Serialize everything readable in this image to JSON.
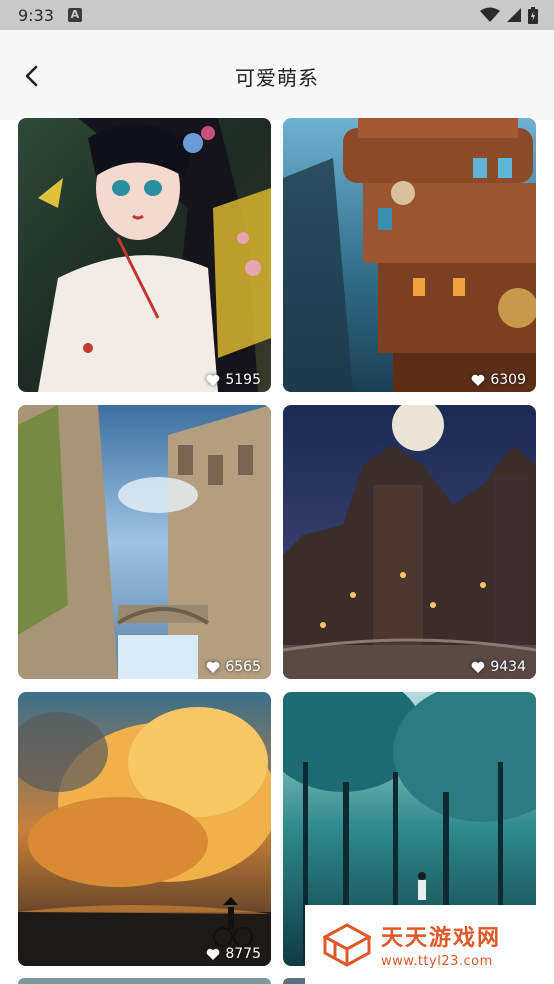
{
  "status_bar": {
    "time": "9:33",
    "notification_icon": "a-notification-icon",
    "icons": [
      "wifi-icon",
      "signal-icon",
      "battery-icon"
    ]
  },
  "header": {
    "title": "可爱萌系",
    "back_icon": "chevron-left-icon"
  },
  "cards": [
    {
      "likes": "5195",
      "art": "anime-girl-flowers"
    },
    {
      "likes": "6309",
      "art": "steampunk-tower"
    },
    {
      "likes": "6565",
      "art": "fantasy-city-canal"
    },
    {
      "likes": "9434",
      "art": "night-castle-moon"
    },
    {
      "likes": "8775",
      "art": "sunset-clouds-cyclist"
    },
    {
      "likes": "",
      "art": "blue-forest"
    }
  ],
  "watermark": {
    "title": "天天游戏网",
    "url": "www.ttyl23.com"
  },
  "colors": {
    "status_bar": "#c9c9c9",
    "header_bg": "#f7f7f7",
    "watermark": "#e0572a"
  }
}
